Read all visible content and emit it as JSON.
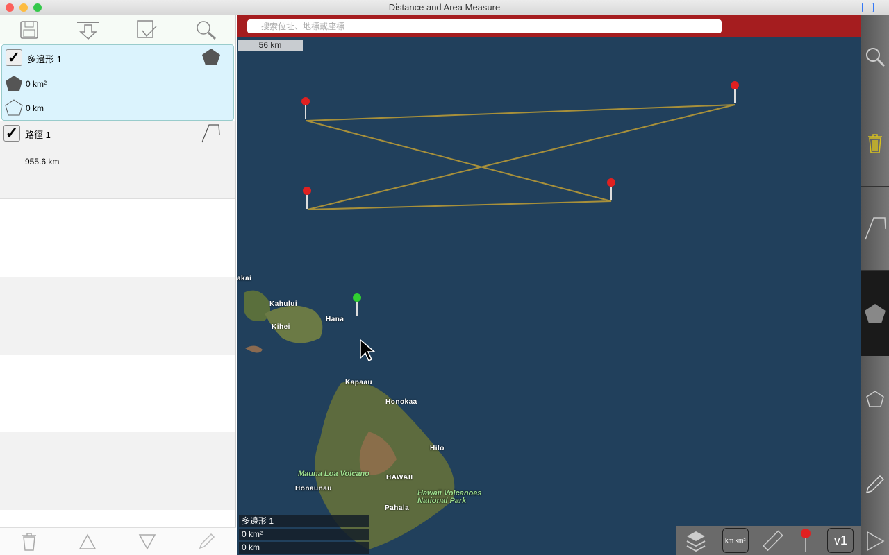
{
  "window": {
    "title": "Distance and Area Measure"
  },
  "sidebar": {
    "items": [
      {
        "name": "多邊形 1",
        "checked": true,
        "area": "0 km²",
        "perimeter": "0 km"
      },
      {
        "name": "路徑 1",
        "checked": true,
        "distance": "955.6 km"
      }
    ],
    "check_mark": "✓"
  },
  "map": {
    "search_placeholder": "搜索位址、地標或座標",
    "scale": "56 km",
    "labels": [
      "Kahului",
      "Kihei",
      "Hana",
      "Kapaau",
      "Honokaa",
      "Hilo",
      "HAWAII",
      "Honaunau",
      "Pahala",
      "akai"
    ],
    "green_labels": [
      "Mauna Loa Volcano",
      "Hawaii Volcanoes",
      "National Park"
    ],
    "info": {
      "name": "多邊形 1",
      "area": "0 km²",
      "distance": "0 km"
    },
    "tools": {
      "units": "km km²",
      "version": "v1"
    },
    "colors": {
      "line": "#a8903a",
      "pin_red": "#e02020",
      "pin_green": "#30d030",
      "search_bar": "#a51d1f"
    }
  }
}
